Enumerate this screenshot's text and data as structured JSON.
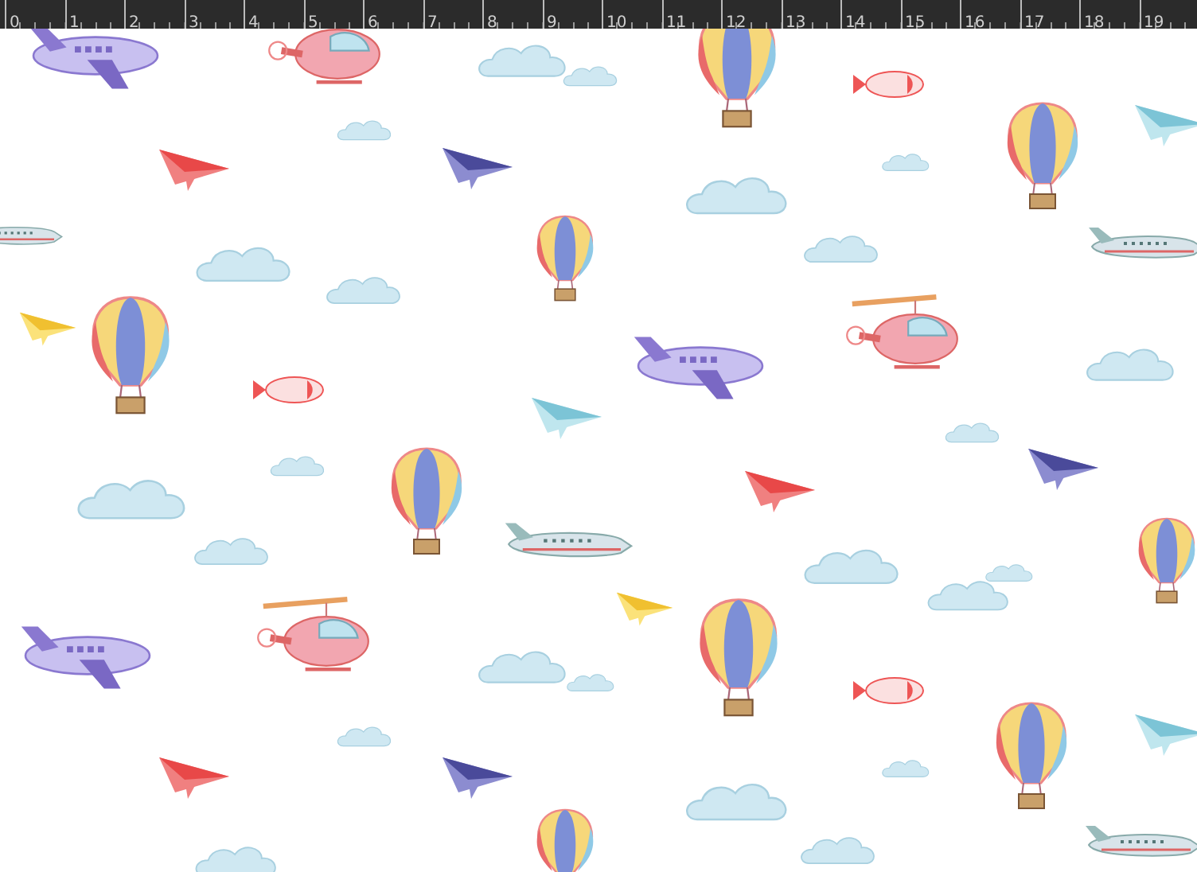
{
  "ruler": {
    "labels": [
      "0",
      "1",
      "2",
      "3",
      "4",
      "5",
      "6",
      "7",
      "8",
      "9",
      "10",
      "11",
      "12",
      "13",
      "14",
      "15",
      "16",
      "17",
      "18",
      "19"
    ]
  }
}
